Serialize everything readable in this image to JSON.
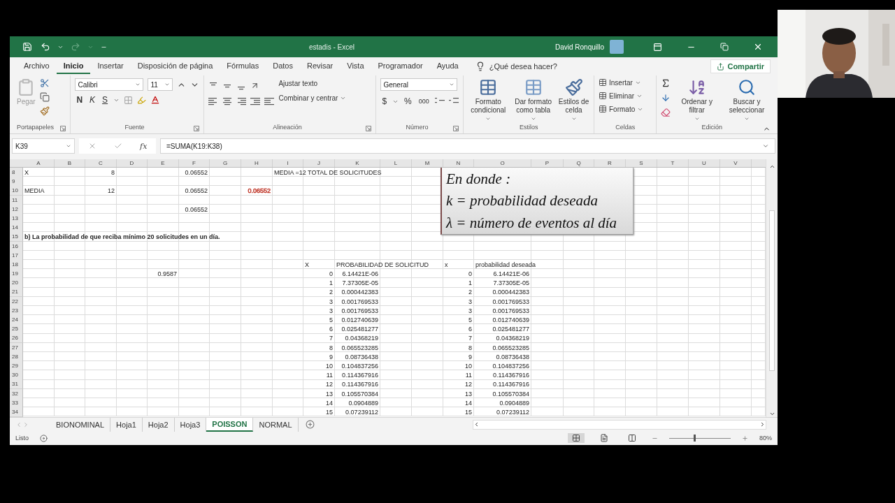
{
  "window": {
    "title": "estadis  -  Excel",
    "user": "David Ronquillo"
  },
  "menu_tabs": [
    {
      "label": "Archivo",
      "selected": false
    },
    {
      "label": "Inicio",
      "selected": true
    },
    {
      "label": "Insertar",
      "selected": false
    },
    {
      "label": "Disposición de página",
      "selected": false
    },
    {
      "label": "Fórmulas",
      "selected": false
    },
    {
      "label": "Datos",
      "selected": false
    },
    {
      "label": "Revisar",
      "selected": false
    },
    {
      "label": "Vista",
      "selected": false
    },
    {
      "label": "Programador",
      "selected": false
    },
    {
      "label": "Ayuda",
      "selected": false
    }
  ],
  "tell_me": "¿Qué desea hacer?",
  "share": "Compartir",
  "ribbon": {
    "clipboard": {
      "paste": "Pegar",
      "group": "Portapapeles"
    },
    "font": {
      "name": "Calibri",
      "size": "11",
      "bold": "N",
      "italic": "K",
      "underline": "S",
      "group": "Fuente"
    },
    "alignment": {
      "wrap": "Ajustar texto",
      "merge": "Combinar y centrar",
      "group": "Alineación"
    },
    "number": {
      "format": "General",
      "currency": "$",
      "percent": "%",
      "thousands": "000",
      "group": "Número"
    },
    "styles": {
      "buttons": [
        "Formato condicional",
        "Dar formato como tabla",
        "Estilos de celda"
      ],
      "group": "Estilos"
    },
    "cells": {
      "buttons": [
        "Insertar",
        "Eliminar",
        "Formato"
      ],
      "group": "Celdas"
    },
    "editing": {
      "buttons": [
        "Ordenar y filtrar",
        "Buscar y seleccionar"
      ],
      "group": "Edición"
    }
  },
  "formula_bar": {
    "name_box": "K39",
    "function_label": "fx",
    "formula": "=SUMA(K19:K38)"
  },
  "sheet": {
    "columns": [
      "A",
      "B",
      "C",
      "D",
      "E",
      "F",
      "G",
      "H",
      "I",
      "J",
      "K",
      "L",
      "M",
      "N",
      "O",
      "P",
      "Q",
      "R",
      "S",
      "T",
      "U",
      "V"
    ],
    "rows": [
      {
        "number": "8",
        "cells": {
          "A": {
            "text": "X",
            "kind": "text"
          },
          "C": {
            "text": "8",
            "kind": "number"
          },
          "F": {
            "text": "0.06552",
            "kind": "number"
          },
          "I": {
            "text": "MEDIA =12 TOTAL DE SOLICITUDES",
            "kind": "text"
          }
        }
      },
      {
        "number": "9",
        "cells": {}
      },
      {
        "number": "10",
        "cells": {
          "A": {
            "text": "MEDIA",
            "kind": "text"
          },
          "C": {
            "text": "12",
            "kind": "number"
          },
          "F": {
            "text": "0.06552",
            "kind": "number"
          },
          "H": {
            "text": "0.06552",
            "kind": "number",
            "color": "#c0392b"
          }
        }
      },
      {
        "number": "11",
        "cells": {}
      },
      {
        "number": "12",
        "cells": {
          "F": {
            "text": "0.06552",
            "kind": "number"
          }
        }
      },
      {
        "number": "13",
        "cells": {}
      },
      {
        "number": "14",
        "cells": {}
      },
      {
        "number": "15",
        "cells": {
          "A": {
            "text": "b) La probabilidad de que reciba mínimo 20 solicitudes en un día.",
            "kind": "text",
            "bold": true
          }
        }
      },
      {
        "number": "16",
        "cells": {}
      },
      {
        "number": "17",
        "cells": {}
      },
      {
        "number": "18",
        "cells": {
          "J": {
            "text": "X",
            "kind": "text"
          },
          "K": {
            "text": "PROBABILIDAD DE SOLICITUD",
            "kind": "text"
          },
          "N": {
            "text": "x",
            "kind": "text"
          },
          "O": {
            "text": "probabilidad deseada",
            "kind": "text"
          }
        }
      },
      {
        "number": "19",
        "cells": {
          "E": {
            "text": "0.9587",
            "kind": "number"
          },
          "J": {
            "text": "0",
            "kind": "number"
          },
          "K": {
            "text": "6.14421E-06",
            "kind": "number"
          },
          "N": {
            "text": "0",
            "kind": "number"
          },
          "O": {
            "text": "6.14421E-06",
            "kind": "number"
          }
        }
      },
      {
        "number": "20",
        "cells": {
          "J": {
            "text": "1",
            "kind": "number"
          },
          "K": {
            "text": "7.37305E-05",
            "kind": "number"
          },
          "N": {
            "text": "1",
            "kind": "number"
          },
          "O": {
            "text": "7.37305E-05",
            "kind": "number"
          }
        }
      },
      {
        "number": "21",
        "cells": {
          "J": {
            "text": "2",
            "kind": "number"
          },
          "K": {
            "text": "0.000442383",
            "kind": "number"
          },
          "N": {
            "text": "2",
            "kind": "number"
          },
          "O": {
            "text": "0.000442383",
            "kind": "number"
          }
        }
      },
      {
        "number": "22",
        "cells": {
          "J": {
            "text": "3",
            "kind": "number"
          },
          "K": {
            "text": "0.001769533",
            "kind": "number"
          },
          "N": {
            "text": "3",
            "kind": "number"
          },
          "O": {
            "text": "0.001769533",
            "kind": "number"
          }
        }
      },
      {
        "number": "23",
        "cells": {
          "J": {
            "text": "3",
            "kind": "number"
          },
          "K": {
            "text": "0.001769533",
            "kind": "number"
          },
          "N": {
            "text": "3",
            "kind": "number"
          },
          "O": {
            "text": "0.001769533",
            "kind": "number"
          }
        }
      },
      {
        "number": "24",
        "cells": {
          "J": {
            "text": "5",
            "kind": "number"
          },
          "K": {
            "text": "0.012740639",
            "kind": "number"
          },
          "N": {
            "text": "5",
            "kind": "number"
          },
          "O": {
            "text": "0.012740639",
            "kind": "number"
          }
        }
      },
      {
        "number": "25",
        "cells": {
          "J": {
            "text": "6",
            "kind": "number"
          },
          "K": {
            "text": "0.025481277",
            "kind": "number"
          },
          "N": {
            "text": "6",
            "kind": "number"
          },
          "O": {
            "text": "0.025481277",
            "kind": "number"
          }
        }
      },
      {
        "number": "26",
        "cells": {
          "J": {
            "text": "7",
            "kind": "number"
          },
          "K": {
            "text": "0.04368219",
            "kind": "number"
          },
          "N": {
            "text": "7",
            "kind": "number"
          },
          "O": {
            "text": "0.04368219",
            "kind": "number"
          }
        }
      },
      {
        "number": "27",
        "cells": {
          "J": {
            "text": "8",
            "kind": "number"
          },
          "K": {
            "text": "0.065523285",
            "kind": "number"
          },
          "N": {
            "text": "8",
            "kind": "number"
          },
          "O": {
            "text": "0.065523285",
            "kind": "number"
          }
        }
      },
      {
        "number": "28",
        "cells": {
          "J": {
            "text": "9",
            "kind": "number"
          },
          "K": {
            "text": "0.08736438",
            "kind": "number"
          },
          "N": {
            "text": "9",
            "kind": "number"
          },
          "O": {
            "text": "0.08736438",
            "kind": "number"
          }
        }
      },
      {
        "number": "29",
        "cells": {
          "J": {
            "text": "10",
            "kind": "number"
          },
          "K": {
            "text": "0.104837256",
            "kind": "number"
          },
          "N": {
            "text": "10",
            "kind": "number"
          },
          "O": {
            "text": "0.104837256",
            "kind": "number"
          }
        }
      },
      {
        "number": "30",
        "cells": {
          "J": {
            "text": "11",
            "kind": "number"
          },
          "K": {
            "text": "0.114367916",
            "kind": "number"
          },
          "N": {
            "text": "11",
            "kind": "number"
          },
          "O": {
            "text": "0.114367916",
            "kind": "number"
          }
        }
      },
      {
        "number": "31",
        "cells": {
          "J": {
            "text": "12",
            "kind": "number"
          },
          "K": {
            "text": "0.114367916",
            "kind": "number"
          },
          "N": {
            "text": "12",
            "kind": "number"
          },
          "O": {
            "text": "0.114367916",
            "kind": "number"
          }
        }
      },
      {
        "number": "32",
        "cells": {
          "J": {
            "text": "13",
            "kind": "number"
          },
          "K": {
            "text": "0.105570384",
            "kind": "number"
          },
          "N": {
            "text": "13",
            "kind": "number"
          },
          "O": {
            "text": "0.105570384",
            "kind": "number"
          }
        }
      },
      {
        "number": "33",
        "cells": {
          "J": {
            "text": "14",
            "kind": "number"
          },
          "K": {
            "text": "0.0904889",
            "kind": "number"
          },
          "N": {
            "text": "14",
            "kind": "number"
          },
          "O": {
            "text": "0.0904889",
            "kind": "number"
          }
        }
      },
      {
        "number": "34",
        "cells": {
          "J": {
            "text": "15",
            "kind": "number"
          },
          "K": {
            "text": "0.07239112",
            "kind": "number"
          },
          "N": {
            "text": "15",
            "kind": "number"
          },
          "O": {
            "text": "0.07239112",
            "kind": "number"
          }
        }
      }
    ],
    "image_box": {
      "lines": [
        "En donde :",
        "k = probabilidad deseada",
        "λ = número de eventos al día"
      ]
    }
  },
  "sheet_tabs": [
    {
      "label": "BIONOMINAL",
      "selected": false
    },
    {
      "label": "Hoja1",
      "selected": false
    },
    {
      "label": "Hoja2",
      "selected": false
    },
    {
      "label": "Hoja3",
      "selected": false
    },
    {
      "label": "POISSON",
      "selected": true
    },
    {
      "label": "NORMAL",
      "selected": false
    }
  ],
  "status_bar": {
    "status": "Listo",
    "zoom": {
      "level": 0.4
    },
    "zoom_text": "80%"
  }
}
